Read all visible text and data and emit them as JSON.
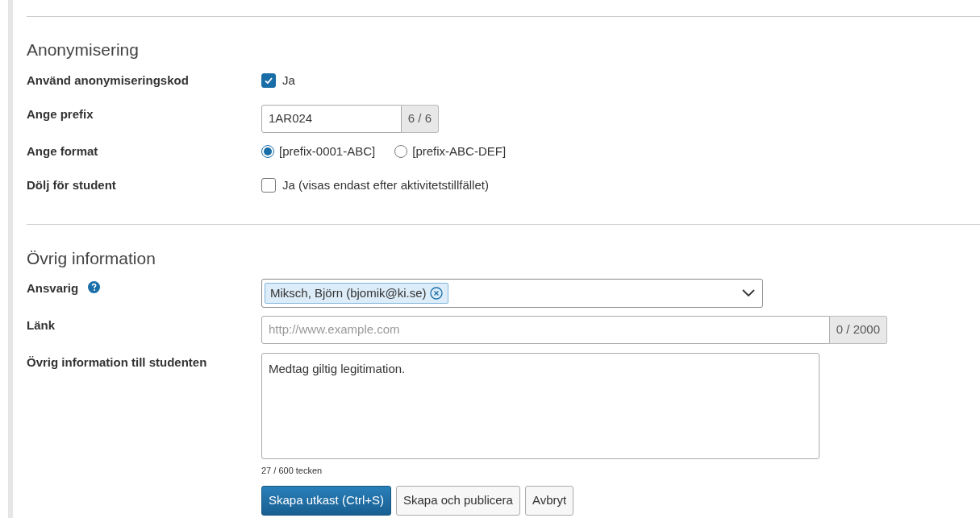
{
  "sections": [
    {
      "title": "Anonymisering",
      "rows": [
        {
          "kind": "checkbox",
          "label": "Använd anonymiseringskod",
          "option": {
            "text": "Ja",
            "checked": true
          }
        },
        {
          "kind": "counted-input",
          "label": "Ange prefix",
          "value": "1AR024",
          "counter": "6 / 6"
        },
        {
          "kind": "radios",
          "label": "Ange format",
          "options": [
            {
              "text": "[prefix-0001-ABC]",
              "selected": true
            },
            {
              "text": "[prefix-ABC-DEF]",
              "selected": false
            }
          ]
        },
        {
          "kind": "checkbox",
          "label": "Dölj för student",
          "option": {
            "text": "Ja (visas endast efter aktivitetstillfället)",
            "checked": false
          }
        }
      ]
    },
    {
      "title": "Övrig information",
      "rows": [
        {
          "kind": "select",
          "label": "Ansvarig",
          "help": true,
          "tags": [
            "Miksch, Björn (bjomik@ki.se)"
          ]
        },
        {
          "kind": "counted-input",
          "label": "Länk",
          "placeholder": "http://www.example.com",
          "counter": "0 / 2000"
        },
        {
          "kind": "textarea",
          "label": "Övrig information till studenten",
          "value": "Medtag giltig legitimation.",
          "counter": "27 / 600 tecken"
        }
      ]
    }
  ],
  "buttons": [
    {
      "label": "Skapa utkast (Ctrl+S)",
      "primary": true
    },
    {
      "label": "Skapa och publicera",
      "primary": false
    },
    {
      "label": "Avbryt",
      "primary": false
    }
  ]
}
